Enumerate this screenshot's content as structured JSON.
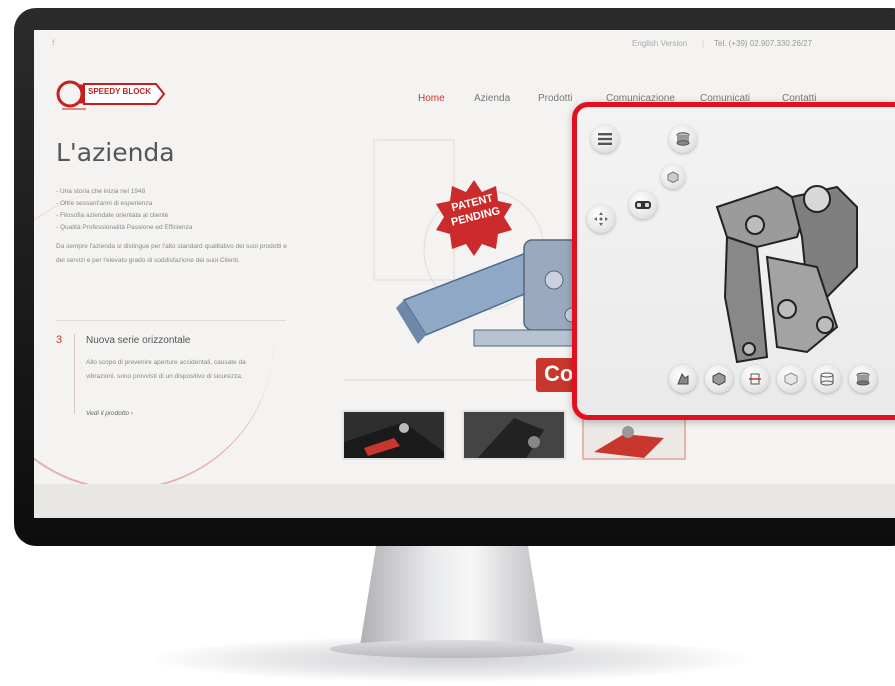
{
  "topbar": {
    "facebook_icon": "f",
    "english_version": "English Version",
    "separator": "|",
    "phone": "Tel. (+39) 02.907.330.26/27"
  },
  "logo": {
    "text": "SPEEDY BLOCK"
  },
  "nav": {
    "items": [
      "Home",
      "Azienda",
      "Prodotti",
      "Comunicazione",
      "Comunicati",
      "Contatti"
    ],
    "active": "Home"
  },
  "hero": {
    "title": "L'azienda",
    "bullets": [
      "- Una storia che inizia nel 1948",
      "- Oltre sessant'anni di esperienza",
      "- Filosofia aziendale orientata al cliente",
      "- Qualità Professionalità Passione ed Efficienza"
    ],
    "paragraph": "Da sempre l'azienda si distingue per l'alto standard qualitativo dei suoi prodotti e dei servizi e per l'elevato grado di soddisfazione dei suoi Clienti.",
    "patent_badge": "PATENT PENDING",
    "co_badge": "Co"
  },
  "feature": {
    "number": "3",
    "title": "Nuova serie orizzontale",
    "description": "Allo scopo di prevenire aperture accidentali, causate da vibrazioni, sono provvisti di un dispositivo di sicurezza.",
    "link": "Vedi il prodotto ›"
  },
  "viewer": {
    "buttons": [
      "list-icon",
      "cylinder-view-icon",
      "cube-view-icon",
      "move-icon",
      "vr-glasses-icon",
      "explode-icon",
      "solid-cube-icon",
      "section-icon",
      "transparent-cube-icon",
      "measure-cylinder-icon",
      "shaded-cylinder-icon"
    ]
  },
  "colors": {
    "brand_red": "#c8372d",
    "viewer_border": "#e3101f",
    "bezel": "#111111"
  }
}
